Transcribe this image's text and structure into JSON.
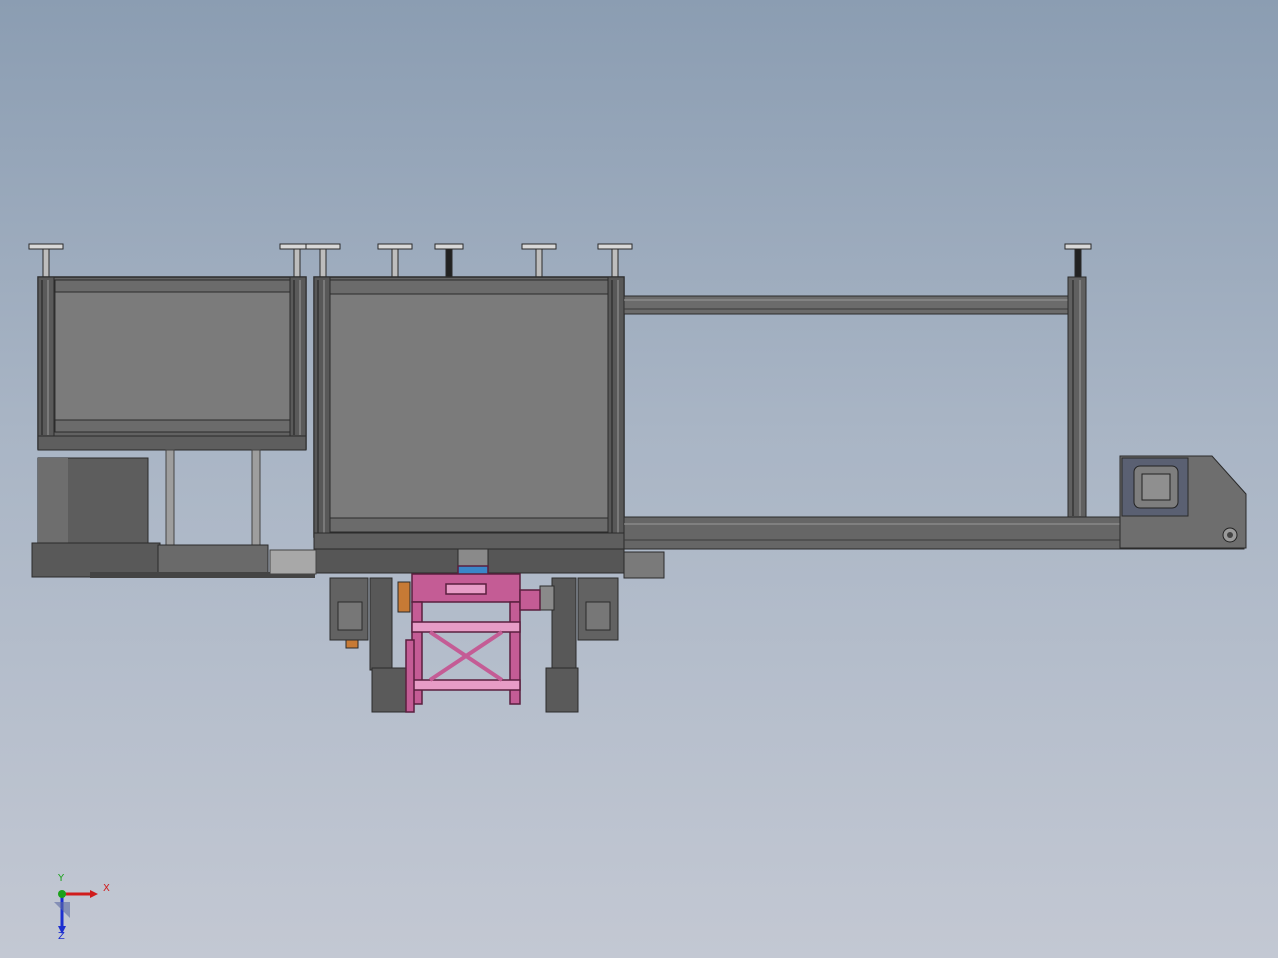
{
  "viewport": {
    "background_top": "#8b9db2",
    "background_bottom": "#c3c8d3"
  },
  "model": {
    "frame_color": "#585858",
    "panel_color": "#7a7a7a",
    "truss_color": "#c45c95",
    "truss_highlight": "#e79cc6",
    "accent_blue": "#3a86c8",
    "accent_orange": "#c77a35"
  },
  "triad": {
    "x_label": "X",
    "y_label": "Y",
    "z_label": "Z",
    "x_color": "#d01c1c",
    "y_color": "#1ba11b",
    "z_color": "#1c2fd0"
  }
}
